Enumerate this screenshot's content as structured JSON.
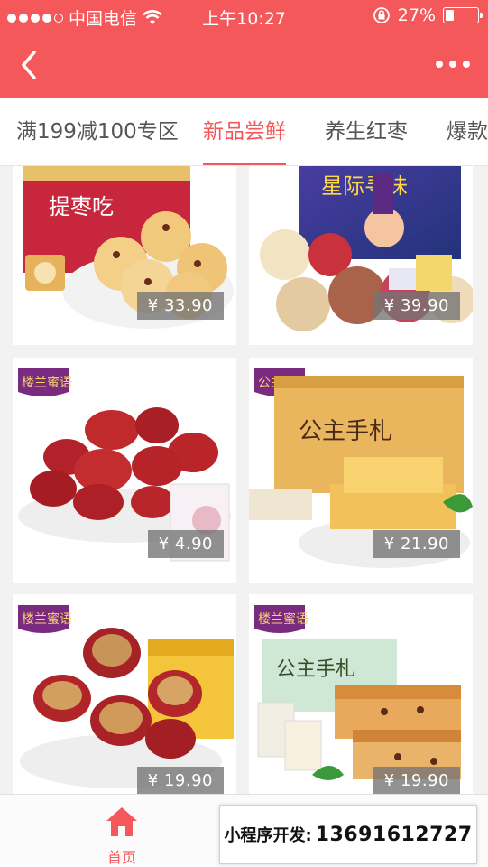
{
  "status_bar": {
    "carrier": "中国电信",
    "time": "上午10:27",
    "battery_percent": "27%",
    "battery_level": 0.27,
    "signal_bars": 4
  },
  "nav": {
    "back_icon": "chevron-left-icon",
    "more_icon": "more-dots-icon"
  },
  "tabs": [
    {
      "label": "满199减100专区",
      "active": false
    },
    {
      "label": "新品尝鲜",
      "active": true
    },
    {
      "label": "养生红枣",
      "active": false
    },
    {
      "label": "爆款",
      "active": false
    }
  ],
  "products": [
    {
      "price": "¥ 33.90"
    },
    {
      "price": "¥ 39.90"
    },
    {
      "price": "¥ 4.90"
    },
    {
      "price": "¥ 21.90"
    },
    {
      "price": "¥ 19.90"
    },
    {
      "price": "¥ 19.90"
    }
  ],
  "product_packaging_text": [
    "提枣吃",
    "星际寻味",
    "楼兰蜜语",
    "公主手札",
    "楼兰蜜语",
    "楼兰蜜语",
    "公主手札"
  ],
  "tabbar": {
    "home_label": "首页",
    "home_icon": "home-icon"
  },
  "ad_banner": {
    "label": "小程序开发:",
    "phone": "13691612727"
  },
  "colors": {
    "accent": "#f4585a",
    "price_badge": "#737373"
  }
}
